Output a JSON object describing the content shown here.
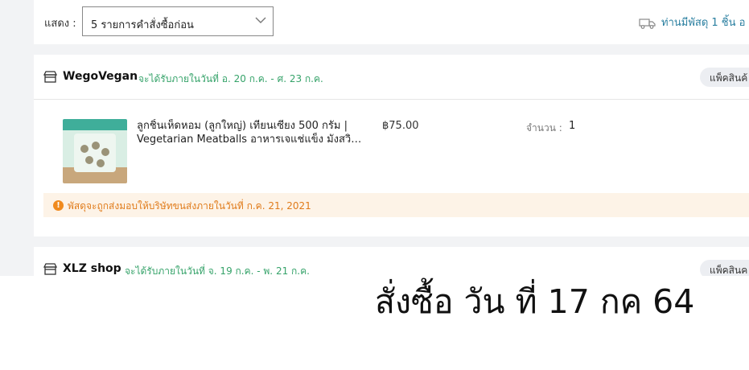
{
  "toolbar": {
    "show_label": "แสดง :",
    "select_value": "5 รายการคำสั่งซื้อก่อน",
    "parcel_info": "ท่านมีพัสดุ 1 ชิ้น อ"
  },
  "shops": [
    {
      "name": "WegoVegan",
      "delivery_estimate": "จะได้รับภายในวันที่ อ. 20 ก.ค. - ศ. 23 ก.ค.",
      "pack_label": "แพ็คสินค้",
      "product": {
        "name_line1": "ลูกชิ้นเห็ดหอม (ลูกใหญ่) เทียนเซียง 500 กรัม |",
        "name_line2": "Vegetarian Meatballs อาหารเจแช่แข็ง มังสวิรั…",
        "price": "฿75.00",
        "qty_label": "จำนวน :",
        "qty": "1"
      },
      "notice": "พัสดุจะถูกส่งมอบให้บริษัทขนส่งภายในวันที่ ก.ค. 21, 2021"
    },
    {
      "name": "XLZ shop",
      "delivery_estimate": "จะได้รับภายในวันที่ จ. 19 ก.ค. - พ. 21 ก.ค.",
      "pack_label": "แพ็คสินค"
    }
  ],
  "caption": "สั่งซื้อ วัน ที่ 17 กค 64",
  "colors": {
    "delivery_green": "#36a36a",
    "notice_orange": "#e07b1a",
    "link_blue": "#2a7fa0"
  }
}
